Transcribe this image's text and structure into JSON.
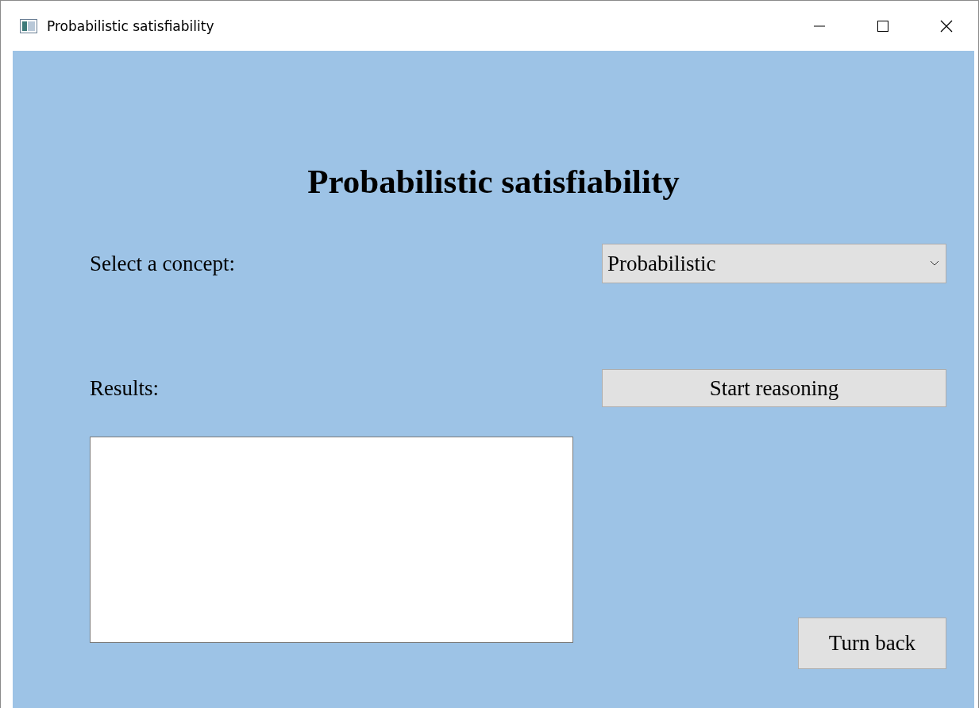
{
  "window": {
    "title": "Probabilistic satisfiability"
  },
  "heading": "Probabilistic satisfiability",
  "concept": {
    "label": "Select a concept:",
    "value": "Probabilistic"
  },
  "results": {
    "label": "Results:"
  },
  "buttons": {
    "start": "Start reasoning",
    "back": "Turn back"
  }
}
